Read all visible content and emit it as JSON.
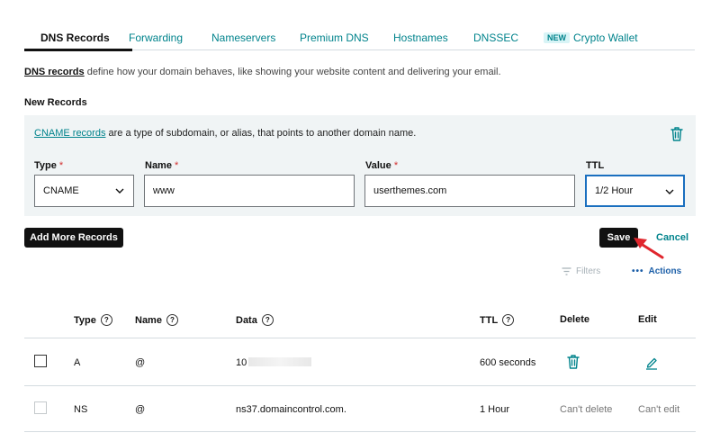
{
  "tabs": [
    {
      "label": "DNS Records"
    },
    {
      "label": "Forwarding"
    },
    {
      "label": "Nameservers"
    },
    {
      "label": "Premium DNS"
    },
    {
      "label": "Hostnames"
    },
    {
      "label": "DNSSEC"
    },
    {
      "label": "Crypto Wallet",
      "badge": "NEW"
    }
  ],
  "intro": {
    "link_text": "DNS records",
    "text": " define how your domain behaves, like showing your website content and delivering your email."
  },
  "new_records": {
    "title": "New Records",
    "info_link": "CNAME records",
    "info_text": " are a type of subdomain, or alias, that points to another domain name.",
    "fields": {
      "type": {
        "label": "Type",
        "required_mark": "*",
        "value": "CNAME"
      },
      "name": {
        "label": "Name",
        "required_mark": "*",
        "value": "www"
      },
      "value": {
        "label": "Value",
        "required_mark": "*",
        "value": "userthemes.com"
      },
      "ttl": {
        "label": "TTL",
        "value": "1/2 Hour"
      }
    },
    "add_more_label": "Add More Records",
    "save_label": "Save",
    "cancel_label": "Cancel"
  },
  "toolbar": {
    "filters_label": "Filters",
    "actions_dots": "•••",
    "actions_label": "Actions"
  },
  "table": {
    "headers": {
      "type": "Type",
      "name": "Name",
      "data": "Data",
      "ttl": "TTL",
      "delete": "Delete",
      "edit": "Edit"
    },
    "help_glyph": "?",
    "rows": [
      {
        "type": "A",
        "name": "@",
        "data": "10",
        "ttl": "600 seconds"
      },
      {
        "type": "NS",
        "name": "@",
        "data": "ns37.domaincontrol.com.",
        "ttl": "1 Hour",
        "delete": "Can't delete",
        "edit": "Can't edit"
      }
    ]
  },
  "colors": {
    "accent": "#00838c",
    "link_blue": "#1c5fa8",
    "required": "#d12c2c",
    "annotation_arrow": "#e0262d",
    "panel_bg": "#f0f4f5"
  },
  "icons": [
    "trash-icon",
    "chevron-down-icon",
    "filter-icon",
    "help-icon",
    "pencil-icon"
  ]
}
